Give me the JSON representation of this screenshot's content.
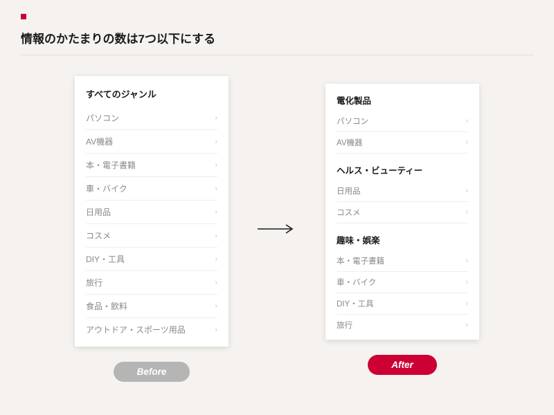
{
  "header": {
    "title": "情報のかたまりの数は7つ以下にする"
  },
  "before": {
    "title": "すべてのジャンル",
    "items": [
      "パソコン",
      "AV機器",
      "本・電子書籍",
      "車・バイク",
      "日用品",
      "コスメ",
      "DIY・工具",
      "旅行",
      "食品・飲料",
      "アウトドア・スポーツ用品"
    ],
    "label": "Before"
  },
  "after": {
    "groups": [
      {
        "title": "電化製品",
        "items": [
          "パソコン",
          "AV機器"
        ]
      },
      {
        "title": "ヘルス・ビューティー",
        "items": [
          "日用品",
          "コスメ"
        ]
      },
      {
        "title": "趣味・娯楽",
        "items": [
          "本・電子書籍",
          "車・バイク",
          "DIY・工具",
          "旅行"
        ]
      }
    ],
    "label": "After"
  }
}
